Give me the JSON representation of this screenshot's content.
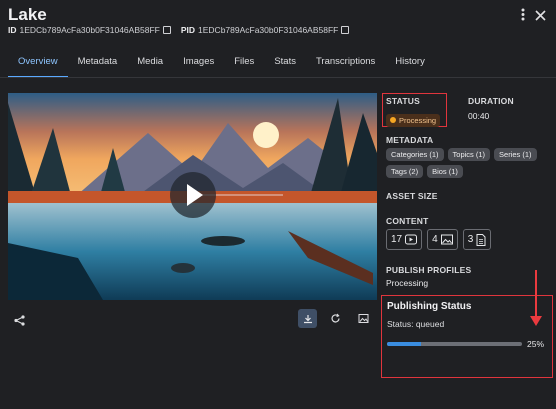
{
  "header": {
    "title": "Lake",
    "id_label": "ID",
    "id_value": "1EDCb789AcFa30b0F31046AB58FF",
    "pid_label": "PID",
    "pid_value": "1EDCb789AcFa30b0F31046AB58FF"
  },
  "tabs": [
    {
      "label": "Overview",
      "active": true
    },
    {
      "label": "Metadata"
    },
    {
      "label": "Media"
    },
    {
      "label": "Images"
    },
    {
      "label": "Files"
    },
    {
      "label": "Stats"
    },
    {
      "label": "Transcriptions"
    },
    {
      "label": "History"
    }
  ],
  "details": {
    "status_label": "STATUS",
    "status_value": "Processing",
    "duration_label": "DURATION",
    "duration_value": "00:40",
    "metadata_label": "METADATA",
    "metadata_chips": [
      "Categories (1)",
      "Topics (1)",
      "Series (1)",
      "Tags (2)",
      "Bios (1)"
    ],
    "asset_size_label": "ASSET SIZE",
    "content_label": "CONTENT",
    "content_counts": {
      "videos": "17",
      "images": "4",
      "documents": "3"
    },
    "publish_profiles_label": "PUBLISH PROFILES",
    "publish_profiles_value": "Processing"
  },
  "publishing": {
    "title": "Publishing Status",
    "status_text": "Status: queued",
    "progress_percent": 25,
    "progress_text": "25%"
  },
  "colors": {
    "background": "#1f2023",
    "accent": "#5aa9ff",
    "highlight": "#e0353d",
    "processing": "#f5a623"
  },
  "icons": [
    "more-vertical-icon",
    "close-icon",
    "copy-icon",
    "play-icon",
    "share-icon",
    "download-icon",
    "refresh-icon",
    "image-icon",
    "video-icon",
    "document-icon"
  ]
}
